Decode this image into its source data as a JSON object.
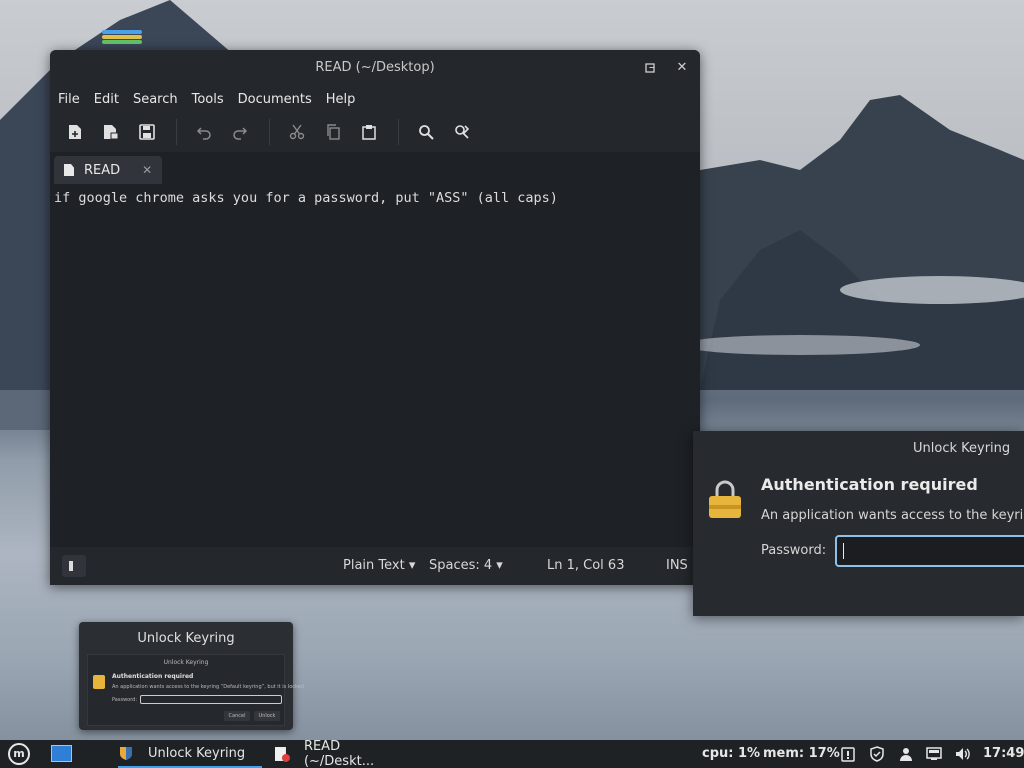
{
  "editor": {
    "title": "READ (~/Desktop)",
    "menu": [
      "File",
      "Edit",
      "Search",
      "Tools",
      "Documents",
      "Help"
    ],
    "tab_label": "READ",
    "content": "if google chrome asks you for a password, put \"ASS\" (all caps)",
    "status": {
      "language": "Plain Text",
      "spaces": "Spaces: 4",
      "position": "Ln 1, Col 63",
      "mode": "INS"
    },
    "icons": {
      "new": "new-document-icon",
      "open": "open-document-icon",
      "save": "save-icon",
      "undo": "undo-icon",
      "redo": "redo-icon",
      "cut": "cut-icon",
      "copy": "copy-icon",
      "paste": "paste-icon",
      "find": "search-icon",
      "replace": "find-replace-icon"
    }
  },
  "keyring_dialog": {
    "title": "Unlock Keyring",
    "heading": "Authentication required",
    "description": "An application wants access to the keyring “",
    "password_label": "Password:",
    "password_value": ""
  },
  "thumbnail": {
    "title": "Unlock Keyring",
    "mini_title": "Unlock Keyring",
    "mini_heading": "Authentication required",
    "mini_description": "An application wants access to the keyring “Default keyring”, but it is locked",
    "mini_password_label": "Password:",
    "mini_cancel": "Cancel",
    "mini_unlock": "Unlock"
  },
  "taskbar": {
    "menu_logo": "m",
    "tasks": [
      {
        "label": "Unlock Keyring",
        "active": true
      },
      {
        "label": "READ (~/Deskt..."
      }
    ],
    "cpu": "cpu: 1%",
    "mem": "mem: 17%",
    "clock": "17:49"
  },
  "colors": {
    "accent": "#3aa4f0",
    "focus_border": "#8fc1e8",
    "lock": "#e8b53c"
  }
}
